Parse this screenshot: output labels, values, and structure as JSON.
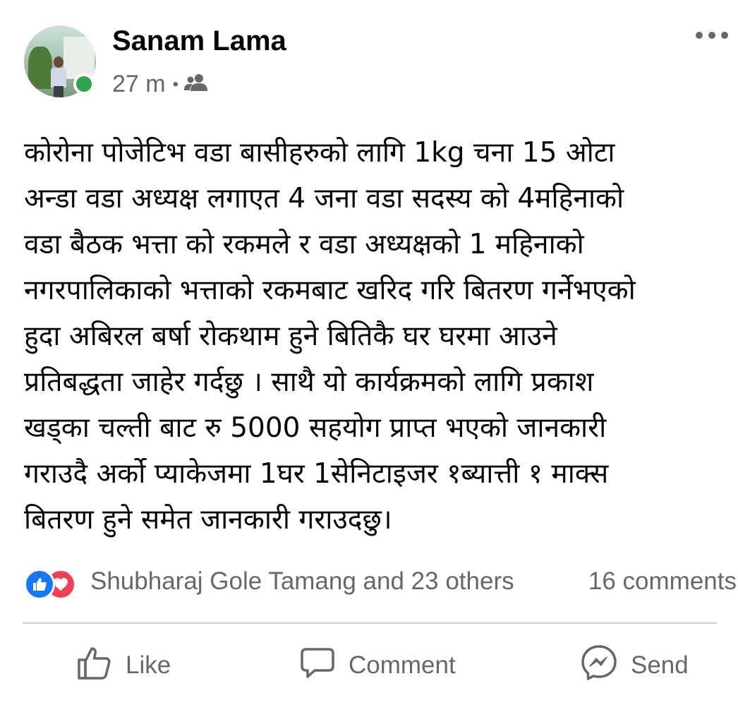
{
  "post": {
    "author": "Sanam Lama",
    "time": "27 m",
    "separator": "•",
    "text": "कोरोना पोजेटिभ वडा बासीहरुको लागि 1kg चना  15 ओटा\nअन्डा  वडा अध्यक्ष  लगाएत 4 जना वडा सदस्य को 4महिनाको\nवडा बैठक भत्ता को रकमले र वडा अध्यक्षको 1 महिनाको\nनगरपालिकाको भत्ताको रकमबाट  खरिद गरि बितरण गर्नेभएको\nहुदा अबिरल बर्षा  रोकथाम हुने बितिकै घर घरमा आउने\nप्रतिबद्धता जाहेर गर्दछु । साथै यो कार्यक्रमको लागि प्रकाश\nखड्का  चल्ती बाट रु 5000 सहयोग प्राप्त भएको जानकारी\nगराउदै  अर्को प्याकेजमा 1घर 1सेनिटाइजर १ब्यात्ती  १ माक्स\nबितरण हुने समेत जानकारी गराउदछु।"
  },
  "reactions": {
    "names": "Shubharaj Gole Tamang and 23 others",
    "comments": "16 comments"
  },
  "actions": {
    "like": "Like",
    "comment": "Comment",
    "send": "Send"
  },
  "icons": {
    "more": "more-horizontal-icon",
    "audience": "friends-icon",
    "like": "thumbs-up-icon",
    "comment": "speech-bubble-icon",
    "send": "messenger-icon"
  },
  "colors": {
    "like_blue": "#1877f2",
    "love_red": "#f33e58",
    "online_green": "#31a24c",
    "secondary_text": "#65676b"
  }
}
